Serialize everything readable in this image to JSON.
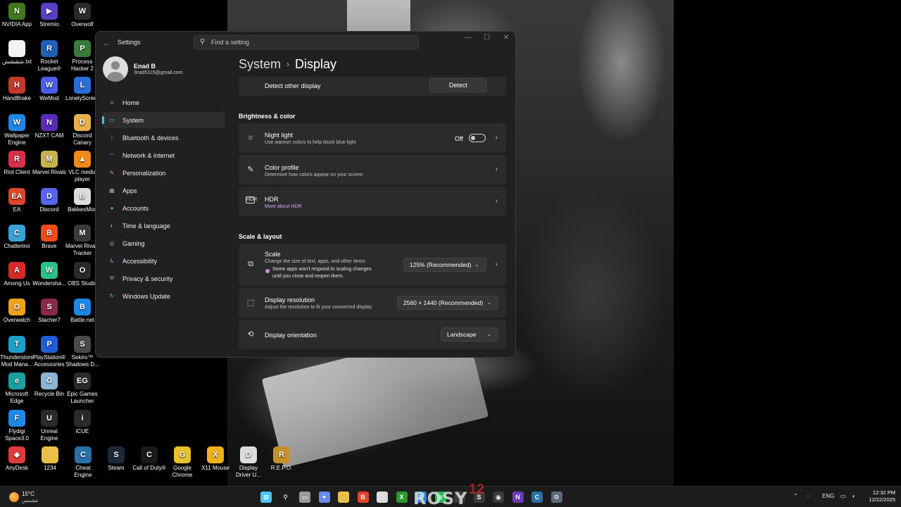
{
  "desktop": {
    "icons": [
      {
        "label": "NVIDIA App",
        "color": "#3f7a1a",
        "glyph": "N"
      },
      {
        "label": "Stremio",
        "color": "#5b3fc4",
        "glyph": "▶"
      },
      {
        "label": "Overwolf",
        "color": "#2a2a2a",
        "glyph": "W"
      },
      {
        "label": "شششش.txt",
        "color": "#f2f2f2",
        "glyph": ""
      },
      {
        "label": "Rocket League®",
        "color": "#1f5fb8",
        "glyph": "R"
      },
      {
        "label": "Process Hacker 2",
        "color": "#3a7a3a",
        "glyph": "P"
      },
      {
        "label": "HandBrake",
        "color": "#c43a2a",
        "glyph": "H"
      },
      {
        "label": "WeMod",
        "color": "#4a5ee8",
        "glyph": "W"
      },
      {
        "label": "LonelyScreen",
        "color": "#2a6fd6",
        "glyph": "L"
      },
      {
        "label": "Wallpaper Engine",
        "color": "#1e88e5",
        "glyph": "W"
      },
      {
        "label": "NZXT CAM",
        "color": "#5a2ab8",
        "glyph": "N"
      },
      {
        "label": "Discord Canary",
        "color": "#e8b04a",
        "glyph": "D"
      },
      {
        "label": "Riot Client",
        "color": "#d6304a",
        "glyph": "R"
      },
      {
        "label": "Marvel Rivals",
        "color": "#c8b24a",
        "glyph": "M"
      },
      {
        "label": "VLC media player",
        "color": "#f08a1a",
        "glyph": "▲"
      },
      {
        "label": "EA",
        "color": "#e0442a",
        "glyph": "EA"
      },
      {
        "label": "Discord",
        "color": "#5865f2",
        "glyph": "D"
      },
      {
        "label": "BakkesMod",
        "color": "#dcdcdc",
        "glyph": "B"
      },
      {
        "label": "Chatterino",
        "color": "#3aa0d6",
        "glyph": "C"
      },
      {
        "label": "Brave",
        "color": "#f04a1a",
        "glyph": "B"
      },
      {
        "label": "Marvel Rivals Tracker",
        "color": "#3a3a3a",
        "glyph": "M"
      },
      {
        "label": "Among Us",
        "color": "#d62a2a",
        "glyph": "A"
      },
      {
        "label": "Wondersha...",
        "color": "#2ac48a",
        "glyph": "W"
      },
      {
        "label": "OBS Studio",
        "color": "#2a2a2a",
        "glyph": "O"
      },
      {
        "label": "Overwatch",
        "color": "#f0a01a",
        "glyph": "O"
      },
      {
        "label": "Stacher7",
        "color": "#8a2a4a",
        "glyph": "S"
      },
      {
        "label": "Battle.net",
        "color": "#1e88e5",
        "glyph": "B"
      },
      {
        "label": "Thunderstore Mod Mana...",
        "color": "#1aa0c8",
        "glyph": "T"
      },
      {
        "label": "PlayStation® Accessories",
        "color": "#1e5fd6",
        "glyph": "P"
      },
      {
        "label": "Sekiro™ Shadows D...",
        "color": "#4a4a4a",
        "glyph": "S"
      },
      {
        "label": "Microsoft Edge",
        "color": "#1aa0a0",
        "glyph": "e"
      },
      {
        "label": "Recycle Bin",
        "color": "#8ab4d6",
        "glyph": "♻"
      },
      {
        "label": "Epic Games Launcher",
        "color": "#2a2a2a",
        "glyph": "EG"
      },
      {
        "label": "Flydigi Space3.0",
        "color": "#1e88e5",
        "glyph": "F"
      },
      {
        "label": "Unreal Engine",
        "color": "#2a2a2a",
        "glyph": "U"
      },
      {
        "label": "iCUE",
        "color": "#2a2a2a",
        "glyph": "i"
      },
      {
        "label": "AnyDesk",
        "color": "#e03a3a",
        "glyph": "◆"
      },
      {
        "label": "1234",
        "color": "#e8c04a",
        "glyph": ""
      },
      {
        "label": "Cheat Engine",
        "color": "#2a6fa8",
        "glyph": "C"
      },
      {
        "label": "Steam",
        "color": "#1b2838",
        "glyph": "S"
      },
      {
        "label": "Call of Duty®",
        "color": "#1a1a1a",
        "glyph": "C"
      },
      {
        "label": "Google Chrome",
        "color": "#e8c02a",
        "glyph": "G"
      },
      {
        "label": "X11 Mouse",
        "color": "#f0b01a",
        "glyph": "X"
      },
      {
        "label": "Display Driver U...",
        "color": "#dcdcdc",
        "glyph": "D"
      },
      {
        "label": "R.E.P.O.",
        "color": "#c8902a",
        "glyph": "R"
      }
    ]
  },
  "settings": {
    "app_title": "Settings",
    "search_placeholder": "Find a setting",
    "user": {
      "name": "Enad B",
      "email": "3nad5115@gmail.com"
    },
    "nav": [
      {
        "label": "Home",
        "icon": "home-icon",
        "color": "#e8e8e8",
        "glyph": "⌂"
      },
      {
        "label": "System",
        "icon": "system-icon",
        "color": "#4cc2ff",
        "glyph": "▭"
      },
      {
        "label": "Bluetooth & devices",
        "icon": "bluetooth-icon",
        "color": "#3a8ee6",
        "glyph": "ᛒ"
      },
      {
        "label": "Network & internet",
        "icon": "wifi-icon",
        "color": "#4cc2ff",
        "glyph": "◠"
      },
      {
        "label": "Personalization",
        "icon": "brush-icon",
        "color": "#e8a040",
        "glyph": "✎"
      },
      {
        "label": "Apps",
        "icon": "apps-icon",
        "color": "#a8a8c8",
        "glyph": "▦"
      },
      {
        "label": "Accounts",
        "icon": "accounts-icon",
        "color": "#3ac48a",
        "glyph": "●"
      },
      {
        "label": "Time & language",
        "icon": "globe-icon",
        "color": "#4cc2ff",
        "glyph": "◐"
      },
      {
        "label": "Gaming",
        "icon": "gamepad-icon",
        "color": "#a0a0b8",
        "glyph": "◎"
      },
      {
        "label": "Accessibility",
        "icon": "accessibility-icon",
        "color": "#4cc2ff",
        "glyph": "♿"
      },
      {
        "label": "Privacy & security",
        "icon": "shield-icon",
        "color": "#a0a0a8",
        "glyph": "⛨"
      },
      {
        "label": "Windows Update",
        "icon": "update-icon",
        "color": "#4cc2ff",
        "glyph": "↻"
      }
    ],
    "active_nav": "System",
    "breadcrumb": {
      "parent": "System",
      "current": "Display"
    },
    "detect": {
      "label": "Detect other display",
      "button": "Detect"
    },
    "sections": {
      "brightness": "Brightness & color",
      "scale": "Scale & layout"
    },
    "night_light": {
      "title": "Night light",
      "subtitle": "Use warmer colors to help block blue light",
      "state": "Off"
    },
    "color_profile": {
      "title": "Color profile",
      "subtitle": "Determine how colors appear on your screen"
    },
    "hdr": {
      "title": "HDR",
      "link": "More about HDR",
      "link_color": "#d9a6ff"
    },
    "scale": {
      "title": "Scale",
      "subtitle": "Change the size of text, apps, and other items",
      "warning_line1": "Some apps won't respond to scaling changes",
      "warning_line2": "until you close and reopen them.",
      "value": "125% (Recommended)"
    },
    "resolution": {
      "title": "Display resolution",
      "subtitle": "Adjust the resolution to fit your connected display",
      "value": "2560 × 1440 (Recommended)"
    },
    "orientation": {
      "title": "Display orientation",
      "value": "Landscape"
    }
  },
  "taskbar": {
    "weather": {
      "temp": "15°C",
      "desc": "مشمس"
    },
    "watermark": "ROSY",
    "watermark_num": "12",
    "apps": [
      {
        "name": "start-icon",
        "color": "#4cc2ff",
        "glyph": "⊞"
      },
      {
        "name": "search-icon",
        "color": "#1c1c1c",
        "glyph": "⚲"
      },
      {
        "name": "task-view-icon",
        "color": "#9a9a9a",
        "glyph": "▭"
      },
      {
        "name": "copilot-icon",
        "color": "#6a8ae8",
        "glyph": "✦"
      },
      {
        "name": "file-explorer-icon",
        "color": "#e8c04a",
        "glyph": ""
      },
      {
        "name": "brave-icon",
        "color": "#e0442a",
        "glyph": "B"
      },
      {
        "name": "notepad-icon",
        "color": "#dcdcdc",
        "glyph": ""
      },
      {
        "name": "xbox-icon",
        "color": "#2a9a2a",
        "glyph": "X"
      },
      {
        "name": "store-icon",
        "color": "#1e88e5",
        "glyph": "⊠"
      },
      {
        "name": "spotify-icon",
        "color": "#1db954",
        "glyph": "≋"
      },
      {
        "name": "speedometer-icon",
        "color": "#3a3a3a",
        "glyph": "◔"
      },
      {
        "name": "steam-icon",
        "color": "#3a3a3a",
        "glyph": "S"
      },
      {
        "name": "obs-icon",
        "color": "#3a3a3a",
        "glyph": "◉"
      },
      {
        "name": "nzxt-icon",
        "color": "#6a3ab8",
        "glyph": "N"
      },
      {
        "name": "cheat-engine-icon",
        "color": "#2a6fa8",
        "glyph": "C"
      },
      {
        "name": "settings-gear-icon",
        "color": "#5a6a7a",
        "glyph": "⚙"
      }
    ],
    "tray": {
      "language": "ENG"
    },
    "clock": {
      "time": "12:32 PM",
      "date": "12/22/2025"
    }
  }
}
